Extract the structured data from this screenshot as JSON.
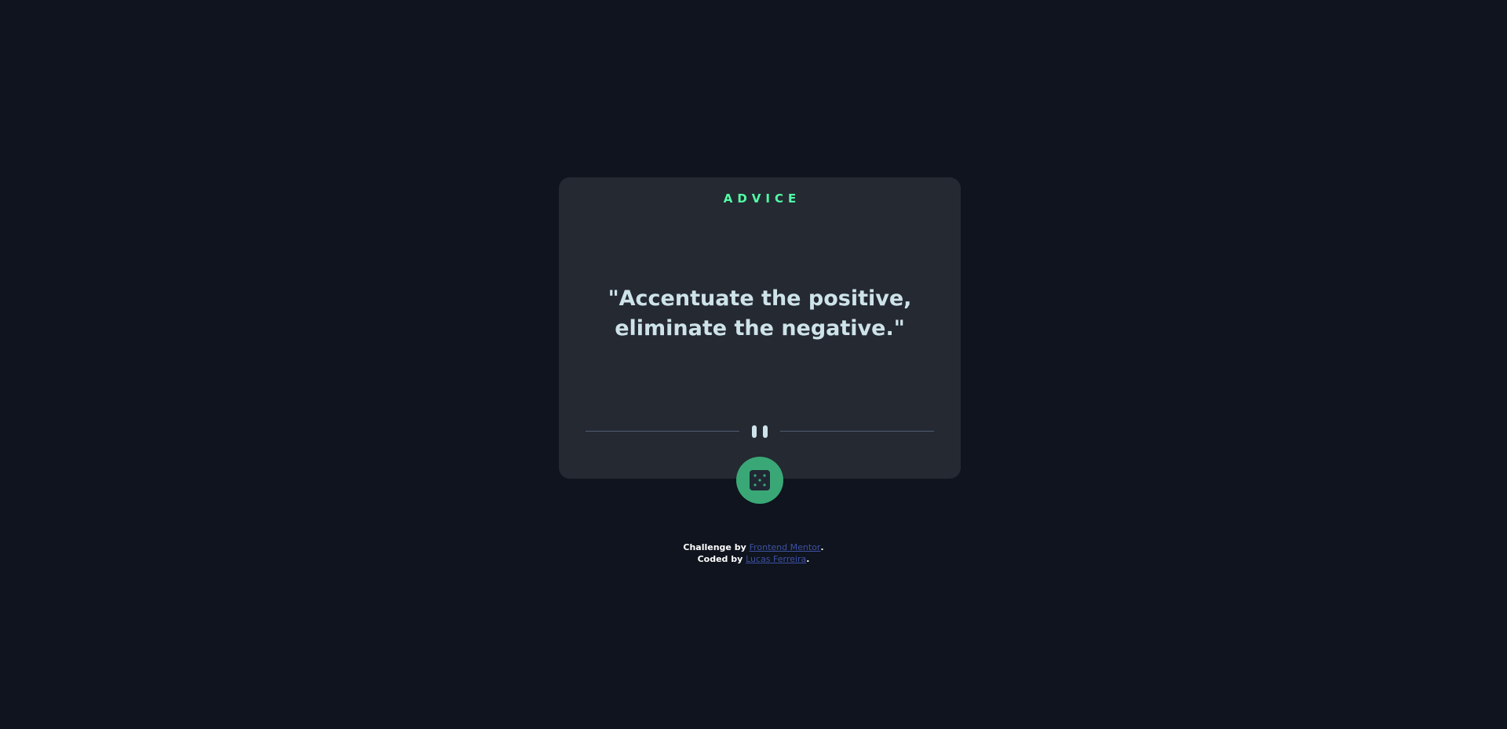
{
  "card": {
    "label": "ADVICE",
    "quote": "\"Accentuate the positive, eliminate the negative.\""
  },
  "icons": {
    "divider": "pause-icon",
    "button": "dice-icon"
  },
  "colors": {
    "background": "#0f141e",
    "card": "#252932",
    "accent": "#52ffa8",
    "quote": "#cee3e9",
    "button": "#3aa876",
    "link": "#3e52a3"
  },
  "attribution": {
    "challenge_prefix": "Challenge by ",
    "challenge_link": "Frontend Mentor",
    "challenge_suffix": ".",
    "coded_prefix": "Coded by ",
    "coded_link": "Lucas Ferreira",
    "coded_suffix": "."
  }
}
